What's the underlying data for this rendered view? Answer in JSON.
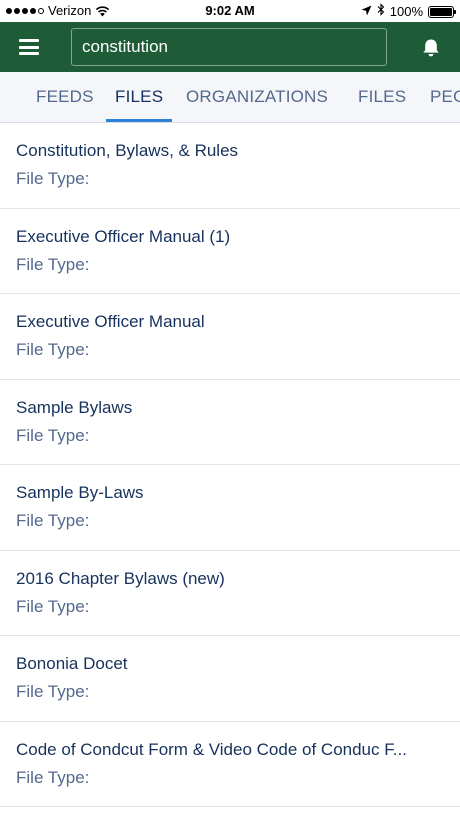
{
  "status_bar": {
    "carrier": "Verizon",
    "time": "9:02 AM",
    "battery": "100%",
    "battery_level": 1.0,
    "signal_bars_filled": 4,
    "signal_bars_total": 5
  },
  "header": {
    "menu_icon": "hamburger-menu-icon",
    "search_value": "constitution",
    "notification_icon": "bell-icon",
    "background_color": "#1e5c38"
  },
  "tabs": [
    {
      "label": "FEEDS",
      "active": false
    },
    {
      "label": "FILES",
      "active": true
    },
    {
      "label": "ORGANIZATIONS",
      "active": false
    },
    {
      "label": "FILES",
      "active": false
    },
    {
      "label": "PEO",
      "active": false
    }
  ],
  "results": [
    {
      "title": "Constitution, Bylaws, & Rules",
      "subtitle": "File Type:"
    },
    {
      "title": "Executive Officer Manual (1)",
      "subtitle": "File Type:"
    },
    {
      "title": "Executive Officer Manual",
      "subtitle": "File Type:"
    },
    {
      "title": "Sample Bylaws",
      "subtitle": "File Type:"
    },
    {
      "title": "Sample By-Laws",
      "subtitle": "File Type:"
    },
    {
      "title": "2016 Chapter Bylaws (new)",
      "subtitle": "File Type:"
    },
    {
      "title": "Bononia Docet",
      "subtitle": "File Type:"
    },
    {
      "title": "Code of Condcut Form & Video Code of Conduc F...",
      "subtitle": "File Type:"
    }
  ],
  "colors": {
    "accent": "#2b82d9",
    "title_text": "#16325c",
    "secondary_text": "#54698d"
  }
}
